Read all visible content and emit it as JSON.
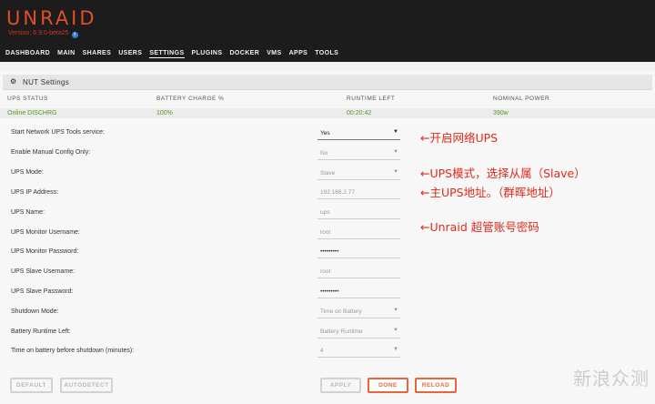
{
  "header": {
    "brand": "UNRAID",
    "version": "Version: 6.9.0-beta25",
    "nav": [
      "DASHBOARD",
      "MAIN",
      "SHARES",
      "USERS",
      "SETTINGS",
      "PLUGINS",
      "DOCKER",
      "VMS",
      "APPS",
      "TOOLS"
    ],
    "active_nav": "SETTINGS"
  },
  "panel": {
    "title": "NUT Settings",
    "status_headers": [
      "UPS STATUS",
      "BATTERY CHARGE %",
      "RUNTIME LEFT",
      "NOMINAL POWER"
    ],
    "status_values": [
      "Online DISCHRG",
      "100%",
      "00:20:42",
      "390w"
    ]
  },
  "form": [
    {
      "label": "Start Network UPS Tools service:",
      "value": "Yes",
      "type": "select"
    },
    {
      "label": "Enable Manual Config Only:",
      "value": "No",
      "type": "select"
    },
    {
      "label": "UPS Mode:",
      "value": "Slave",
      "type": "select"
    },
    {
      "label": "UPS IP Address:",
      "value": "192.168.2.77",
      "type": "text"
    },
    {
      "label": "UPS Name:",
      "value": "ups",
      "type": "text"
    },
    {
      "label": "UPS Monitor Username:",
      "value": "root",
      "type": "text"
    },
    {
      "label": "UPS Monitor Password:",
      "value": "•••••••••",
      "type": "password"
    },
    {
      "label": "UPS Slave Username:",
      "value": "root",
      "type": "text"
    },
    {
      "label": "UPS Slave Password:",
      "value": "•••••••••",
      "type": "password"
    },
    {
      "label": "Shutdown Mode:",
      "value": "Time on Battery",
      "type": "select"
    },
    {
      "label": "Battery Runtime Left:",
      "value": "Battery Runtime",
      "type": "select"
    },
    {
      "label": "Time on battery before shutdown (minutes):",
      "value": "4",
      "type": "select"
    }
  ],
  "buttons": {
    "default": "DEFAULT",
    "autodetect": "AUTODETECT",
    "apply": "APPLY",
    "done": "DONE",
    "reload": "RELOAD"
  },
  "annotations": [
    "←开启网络UPS",
    "←UPS模式，选择从属（Slave）",
    "←主UPS地址。（群晖地址）",
    "←Unraid 超管账号密码"
  ],
  "watermark": "新浪众测",
  "colors": {
    "brand": "#e34e2a",
    "status_green": "#4d9a1d",
    "annotation_red": "#e2291a",
    "button_orange": "#e8653a"
  }
}
